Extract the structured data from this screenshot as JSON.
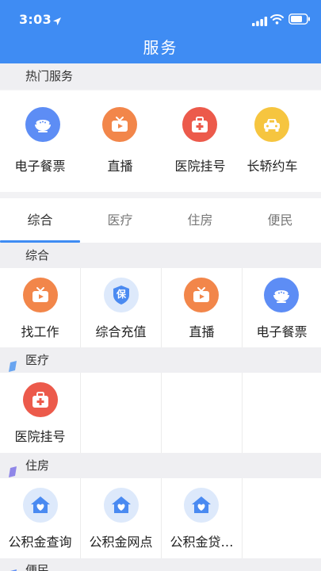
{
  "status_bar": {
    "time": "3:03"
  },
  "header": {
    "title": "服务"
  },
  "hot_services": {
    "heading": "热门服务",
    "items": [
      {
        "label": "电子餐票",
        "icon": "meal-ticket-icon",
        "color": "#5d8df5"
      },
      {
        "label": "直播",
        "icon": "live-tv-icon",
        "color": "#f2864a"
      },
      {
        "label": "医院挂号",
        "icon": "medical-kit-icon",
        "color": "#ec5a4b"
      },
      {
        "label": "长轿约车",
        "icon": "car-icon",
        "color": "#f6c53f"
      }
    ]
  },
  "tabs": [
    {
      "label": "综合",
      "active": true
    },
    {
      "label": "医疗",
      "active": false
    },
    {
      "label": "住房",
      "active": false
    },
    {
      "label": "便民",
      "active": false
    }
  ],
  "sections": {
    "general": {
      "heading": "综合",
      "items": [
        {
          "label": "找工作",
          "icon": "live-tv-icon"
        },
        {
          "label": "综合充值",
          "icon": "shield-bao-icon",
          "glyph": "保"
        },
        {
          "label": "直播",
          "icon": "live-tv-icon"
        },
        {
          "label": "电子餐票",
          "icon": "meal-ticket-icon"
        }
      ]
    },
    "medical": {
      "heading": "医疗",
      "flag_color": "#6aa5f0",
      "items": [
        {
          "label": "医院挂号",
          "icon": "medical-kit-icon"
        }
      ]
    },
    "housing": {
      "heading": "住房",
      "flag_color": "#8f86e8",
      "items": [
        {
          "label": "公积金查询",
          "icon": "house-heart-icon"
        },
        {
          "label": "公积金网点",
          "icon": "house-heart-icon"
        },
        {
          "label": "公积金贷…",
          "icon": "house-heart-icon"
        }
      ]
    },
    "convenience": {
      "heading": "便民",
      "flag_color": "#5d8df5"
    }
  },
  "colors": {
    "header_bg": "#3f8cf3",
    "accent": "#3f8cf3",
    "live_orange": "#f2864a",
    "meal_blue": "#5d8df5",
    "medical_red": "#ec5a4b",
    "car_yellow": "#f6c53f",
    "light_blue_bg": "#dde9fb"
  }
}
